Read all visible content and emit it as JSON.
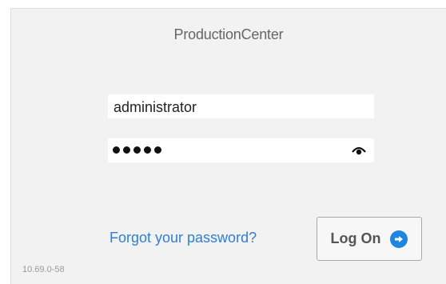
{
  "app": {
    "title": "ProductionCenter"
  },
  "login": {
    "username_value": "administrator",
    "password_mask_count": 5,
    "forgot_label": "Forgot your password?",
    "logon_label": "Log On"
  },
  "footer": {
    "version": "10.69.0-58"
  },
  "colors": {
    "accent": "#1f86e0",
    "link": "#2f7fd6",
    "panel_bg": "#f2f2f2"
  },
  "icons": {
    "password_toggle": "eye-icon",
    "submit": "arrow-right-circle-icon"
  }
}
